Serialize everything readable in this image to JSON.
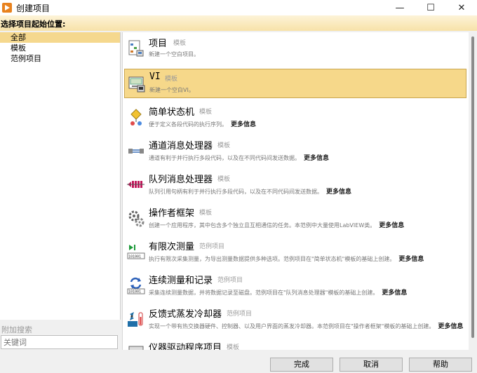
{
  "window": {
    "title": "创建项目",
    "minimize": "—",
    "maximize": "☐",
    "close": "✕"
  },
  "header": {
    "label": "选择项目起始位置:"
  },
  "categories": [
    {
      "label": "全部",
      "selected": true
    },
    {
      "label": "模板",
      "selected": false
    },
    {
      "label": "范例项目",
      "selected": false
    }
  ],
  "search": {
    "label": "附加搜索",
    "placeholder": "关键词",
    "value": ""
  },
  "templates": [
    {
      "name": "项目",
      "tag": "模板",
      "desc": "新建一个空白项目。",
      "more": "",
      "icon": "project-icon",
      "selected": false
    },
    {
      "name": "VI",
      "tag": "模板",
      "desc": "新建一个空白VI。",
      "more": "",
      "icon": "vi-icon",
      "selected": true
    },
    {
      "name": "简单状态机",
      "tag": "模板",
      "desc": "便于定义各段代码的执行序列。",
      "more": "更多信息",
      "icon": "state-machine-icon",
      "selected": false
    },
    {
      "name": "通道消息处理器",
      "tag": "模板",
      "desc": "通道有利于并行执行多段代码，以及在不同代码间发送数据。",
      "more": "更多信息",
      "icon": "channel-icon",
      "selected": false
    },
    {
      "name": "队列消息处理器",
      "tag": "模板",
      "desc": "队列引用句柄有利于并行执行多段代码，以及在不同代码间发送数据。",
      "more": "更多信息",
      "icon": "queue-icon",
      "selected": false
    },
    {
      "name": "操作者框架",
      "tag": "模板",
      "desc": "创建一个应用程序，其中包含多个独立且互相通信的任务。本范例中大量使用LabVIEW类。",
      "more": "更多信息",
      "icon": "gears-icon",
      "selected": false
    },
    {
      "name": "有限次测量",
      "tag": "范例项目",
      "desc": "执行有限次采集测量，为导出测量数据提供多种选项。范例项目在\"简单状态机\"模板的基础上创建。",
      "more": "更多信息",
      "icon": "finite-measure-icon",
      "selected": false
    },
    {
      "name": "连续测量和记录",
      "tag": "范例项目",
      "desc": "采集连续测量数据，并将数据记录至磁盘。范例项目在\"队列消息处理器\"模板的基础上创建。",
      "more": "更多信息",
      "icon": "continuous-measure-icon",
      "selected": false
    },
    {
      "name": "反馈式蒸发冷却器",
      "tag": "范例项目",
      "desc": "实现一个带有热交换器硬件、控制器、以及用户界面的蒸发冷却器。本范例项目在\"操作者框架\"模板的基础上创建。",
      "more": "更多信息",
      "icon": "cooler-icon",
      "selected": false
    },
    {
      "name": "仪器驱动程序项目",
      "tag": "模板",
      "desc": "",
      "more": "",
      "icon": "instrument-icon",
      "selected": false
    }
  ],
  "buttons": {
    "finish": "完成",
    "cancel": "取消",
    "help": "帮助"
  },
  "colors": {
    "selection": "#f6d88a",
    "header_band": "#f7e2a8",
    "app_icon": "#e8821e"
  }
}
